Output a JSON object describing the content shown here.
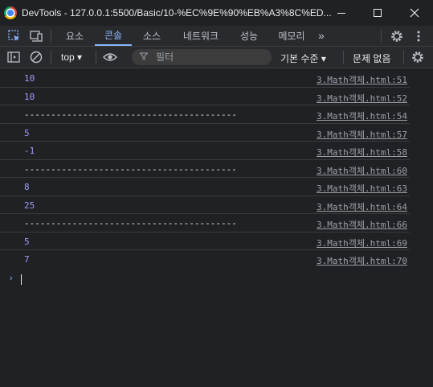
{
  "window": {
    "title": "DevTools - 127.0.0.1:5500/Basic/10-%EC%9E%90%EB%A3%8C%ED..."
  },
  "tabs": [
    {
      "label": "요소",
      "active": false
    },
    {
      "label": "콘솔",
      "active": true
    },
    {
      "label": "소스",
      "active": false
    },
    {
      "label": "네트워크",
      "active": false
    },
    {
      "label": "성능",
      "active": false
    },
    {
      "label": "메모리",
      "active": false
    }
  ],
  "toolbar": {
    "context": "top",
    "filter_placeholder": "필터",
    "levels_label": "기본 수준",
    "issues_label": "문제 없음"
  },
  "console": {
    "rows": [
      {
        "value": "10",
        "type": "number",
        "source": "3.Math객체.html:51"
      },
      {
        "value": "10",
        "type": "number",
        "source": "3.Math객체.html:52"
      },
      {
        "value": "----------------------------------------",
        "type": "text",
        "source": "3.Math객체.html:54"
      },
      {
        "value": "5",
        "type": "number",
        "source": "3.Math객체.html:57"
      },
      {
        "value": "-1",
        "type": "number",
        "source": "3.Math객체.html:58"
      },
      {
        "value": "----------------------------------------",
        "type": "text",
        "source": "3.Math객체.html:60"
      },
      {
        "value": "8",
        "type": "number",
        "source": "3.Math객체.html:63"
      },
      {
        "value": "25",
        "type": "number",
        "source": "3.Math객체.html:64"
      },
      {
        "value": "----------------------------------------",
        "type": "text",
        "source": "3.Math객체.html:66"
      },
      {
        "value": "5",
        "type": "number",
        "source": "3.Math객체.html:69"
      },
      {
        "value": "7",
        "type": "number",
        "source": "3.Math객체.html:70"
      }
    ]
  },
  "colors": {
    "number": "#9c9cf7",
    "link": "#9aa0a6",
    "active_tab": "#8ab4f8",
    "background": "#202124"
  }
}
